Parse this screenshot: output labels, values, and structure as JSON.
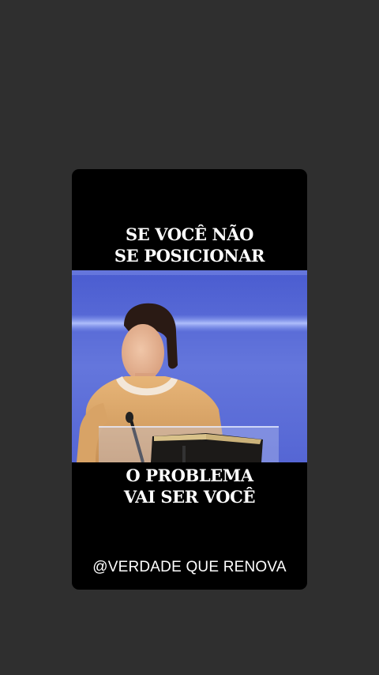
{
  "post": {
    "top_caption": [
      "SE VOCÊ NÃO",
      "SE POSICIONAR"
    ],
    "bottom_caption": [
      "O PROBLEMA",
      "VAI SER VOCÊ"
    ],
    "handle": "@VERDADE QUE RENOVA"
  },
  "colors": {
    "background": "#2f2f2f",
    "card": "#000000",
    "text": "#ffffff",
    "stage_blue": "#5a6fd8"
  }
}
